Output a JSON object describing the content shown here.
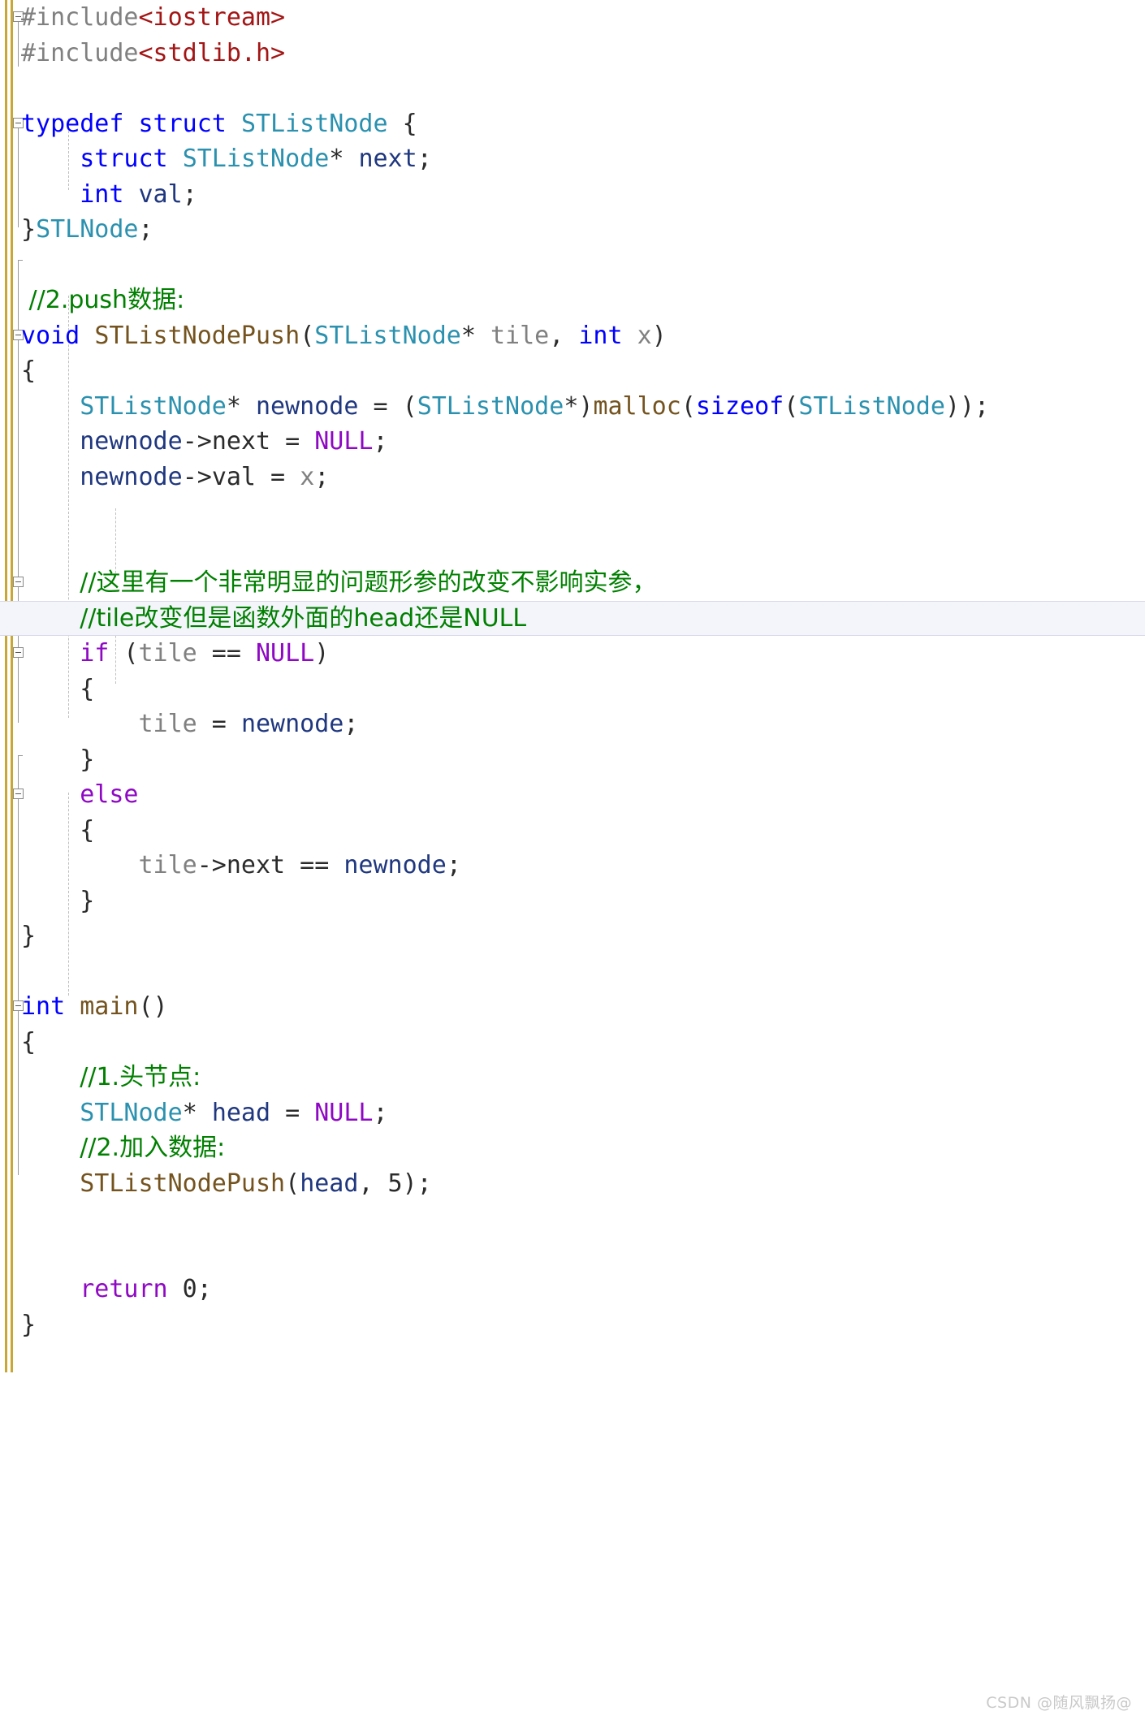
{
  "app": {
    "kind": "code-editor",
    "language": "C",
    "theme": "light"
  },
  "colors": {
    "background": "#ffffff",
    "keyword_blue": "#0000ff",
    "keyword_purple": "#8f08c4",
    "user_type_teal": "#2b91af",
    "function_brown": "#74531f",
    "preprocessor_gray": "#808080",
    "include_string_red": "#a31515",
    "comment_green": "#008000",
    "local_variable_navy": "#1f377f",
    "plain_text": "#2b2b2b",
    "change_bar": "#c8a734",
    "current_line_highlight": "#f4f4fb",
    "watermark": "#c9c9c9"
  },
  "watermark": {
    "text": "CSDN @随风飘扬@"
  },
  "code": {
    "lines": [
      {
        "n": 1,
        "fold": true,
        "current": false,
        "text": "#include<iostream>",
        "tokens": [
          {
            "t": "#include",
            "c": "pre"
          },
          {
            "t": "<iostream>",
            "c": "str"
          }
        ]
      },
      {
        "n": 2,
        "fold": false,
        "current": false,
        "text": "#include<stdlib.h>",
        "tokens": [
          {
            "t": "#include",
            "c": "pre"
          },
          {
            "t": "<stdlib.h>",
            "c": "str"
          }
        ]
      },
      {
        "n": 3,
        "fold": false,
        "current": false,
        "text": "",
        "tokens": []
      },
      {
        "n": 4,
        "fold": true,
        "current": false,
        "text": "typedef struct STListNode {",
        "tokens": [
          {
            "t": "typedef",
            "c": "kw"
          },
          {
            "t": " ",
            "c": "plain"
          },
          {
            "t": "struct",
            "c": "kw"
          },
          {
            "t": " ",
            "c": "plain"
          },
          {
            "t": "STListNode",
            "c": "type"
          },
          {
            "t": " {",
            "c": "plain"
          }
        ]
      },
      {
        "n": 5,
        "fold": false,
        "current": false,
        "text": "    struct STListNode* next;",
        "tokens": [
          {
            "t": "    ",
            "c": "plain"
          },
          {
            "t": "struct",
            "c": "kw"
          },
          {
            "t": " ",
            "c": "plain"
          },
          {
            "t": "STListNode",
            "c": "type"
          },
          {
            "t": "* ",
            "c": "plain"
          },
          {
            "t": "next",
            "c": "var"
          },
          {
            "t": ";",
            "c": "plain"
          }
        ]
      },
      {
        "n": 6,
        "fold": false,
        "current": false,
        "text": "    int val;",
        "tokens": [
          {
            "t": "    ",
            "c": "plain"
          },
          {
            "t": "int",
            "c": "kw"
          },
          {
            "t": " ",
            "c": "plain"
          },
          {
            "t": "val",
            "c": "var"
          },
          {
            "t": ";",
            "c": "plain"
          }
        ]
      },
      {
        "n": 7,
        "fold": false,
        "current": false,
        "text": "}STLNode;",
        "tokens": [
          {
            "t": "}",
            "c": "plain"
          },
          {
            "t": "STLNode",
            "c": "type"
          },
          {
            "t": ";",
            "c": "plain"
          }
        ]
      },
      {
        "n": 8,
        "fold": false,
        "current": false,
        "text": "",
        "tokens": []
      },
      {
        "n": 9,
        "fold": false,
        "current": false,
        "text": " //2.push数据:",
        "tokens": [
          {
            "t": " //2.push数据:",
            "c": "com"
          }
        ]
      },
      {
        "n": 10,
        "fold": true,
        "current": false,
        "text": "void STListNodePush(STListNode* tile, int x)",
        "tokens": [
          {
            "t": "void",
            "c": "kw"
          },
          {
            "t": " ",
            "c": "plain"
          },
          {
            "t": "STListNodePush",
            "c": "fn"
          },
          {
            "t": "(",
            "c": "plain"
          },
          {
            "t": "STListNode",
            "c": "type"
          },
          {
            "t": "* ",
            "c": "plain"
          },
          {
            "t": "tile",
            "c": "param"
          },
          {
            "t": ", ",
            "c": "plain"
          },
          {
            "t": "int",
            "c": "kw"
          },
          {
            "t": " ",
            "c": "plain"
          },
          {
            "t": "x",
            "c": "param"
          },
          {
            "t": ")",
            "c": "plain"
          }
        ]
      },
      {
        "n": 11,
        "fold": false,
        "current": false,
        "text": "{",
        "tokens": [
          {
            "t": "{",
            "c": "plain"
          }
        ]
      },
      {
        "n": 12,
        "fold": false,
        "current": false,
        "text": "    STListNode* newnode = (STListNode*)malloc(sizeof(STListNode));",
        "tokens": [
          {
            "t": "    ",
            "c": "plain"
          },
          {
            "t": "STListNode",
            "c": "type"
          },
          {
            "t": "* ",
            "c": "plain"
          },
          {
            "t": "newnode",
            "c": "var"
          },
          {
            "t": " = (",
            "c": "plain"
          },
          {
            "t": "STListNode",
            "c": "type"
          },
          {
            "t": "*)",
            "c": "plain"
          },
          {
            "t": "malloc",
            "c": "fn"
          },
          {
            "t": "(",
            "c": "plain"
          },
          {
            "t": "sizeof",
            "c": "kw"
          },
          {
            "t": "(",
            "c": "plain"
          },
          {
            "t": "STListNode",
            "c": "type"
          },
          {
            "t": "));",
            "c": "plain"
          }
        ]
      },
      {
        "n": 13,
        "fold": false,
        "current": false,
        "text": "    newnode->next = NULL;",
        "tokens": [
          {
            "t": "    ",
            "c": "plain"
          },
          {
            "t": "newnode",
            "c": "var"
          },
          {
            "t": "->",
            "c": "plain"
          },
          {
            "t": "next",
            "c": "plain"
          },
          {
            "t": " = ",
            "c": "plain"
          },
          {
            "t": "NULL",
            "c": "kw2"
          },
          {
            "t": ";",
            "c": "plain"
          }
        ]
      },
      {
        "n": 14,
        "fold": false,
        "current": false,
        "text": "    newnode->val = x;",
        "tokens": [
          {
            "t": "    ",
            "c": "plain"
          },
          {
            "t": "newnode",
            "c": "var"
          },
          {
            "t": "->",
            "c": "plain"
          },
          {
            "t": "val",
            "c": "plain"
          },
          {
            "t": " = ",
            "c": "plain"
          },
          {
            "t": "x",
            "c": "param"
          },
          {
            "t": ";",
            "c": "plain"
          }
        ]
      },
      {
        "n": 15,
        "fold": false,
        "current": false,
        "text": "",
        "tokens": []
      },
      {
        "n": 16,
        "fold": false,
        "current": false,
        "text": "",
        "tokens": []
      },
      {
        "n": 17,
        "fold": true,
        "current": false,
        "text": "    //这里有一个非常明显的问题形参的改变不影响实参，",
        "tokens": [
          {
            "t": "    ",
            "c": "plain"
          },
          {
            "t": "//这里有一个非常明显的问题形参的改变不影响实参，",
            "c": "com"
          }
        ]
      },
      {
        "n": 18,
        "fold": false,
        "current": true,
        "text": "    //tile改变但是函数外面的head还是NULL",
        "tokens": [
          {
            "t": "    ",
            "c": "plain"
          },
          {
            "t": "//tile改变但是函数外面的head还是NULL",
            "c": "com"
          }
        ]
      },
      {
        "n": 19,
        "fold": true,
        "current": false,
        "text": "    if (tile == NULL)",
        "tokens": [
          {
            "t": "    ",
            "c": "plain"
          },
          {
            "t": "if",
            "c": "kw2"
          },
          {
            "t": " (",
            "c": "plain"
          },
          {
            "t": "tile",
            "c": "param"
          },
          {
            "t": " == ",
            "c": "plain"
          },
          {
            "t": "NULL",
            "c": "kw2"
          },
          {
            "t": ")",
            "c": "plain"
          }
        ]
      },
      {
        "n": 20,
        "fold": false,
        "current": false,
        "text": "    {",
        "tokens": [
          {
            "t": "    {",
            "c": "plain"
          }
        ]
      },
      {
        "n": 21,
        "fold": false,
        "current": false,
        "text": "        tile = newnode;",
        "tokens": [
          {
            "t": "        ",
            "c": "plain"
          },
          {
            "t": "tile",
            "c": "param"
          },
          {
            "t": " = ",
            "c": "plain"
          },
          {
            "t": "newnode",
            "c": "var"
          },
          {
            "t": ";",
            "c": "plain"
          }
        ]
      },
      {
        "n": 22,
        "fold": false,
        "current": false,
        "text": "    }",
        "tokens": [
          {
            "t": "    }",
            "c": "plain"
          }
        ]
      },
      {
        "n": 23,
        "fold": true,
        "current": false,
        "text": "    else",
        "tokens": [
          {
            "t": "    ",
            "c": "plain"
          },
          {
            "t": "else",
            "c": "kw2"
          }
        ]
      },
      {
        "n": 24,
        "fold": false,
        "current": false,
        "text": "    {",
        "tokens": [
          {
            "t": "    {",
            "c": "plain"
          }
        ]
      },
      {
        "n": 25,
        "fold": false,
        "current": false,
        "text": "        tile->next == newnode;",
        "tokens": [
          {
            "t": "        ",
            "c": "plain"
          },
          {
            "t": "tile",
            "c": "param"
          },
          {
            "t": "->",
            "c": "plain"
          },
          {
            "t": "next",
            "c": "plain"
          },
          {
            "t": " == ",
            "c": "plain"
          },
          {
            "t": "newnode",
            "c": "var"
          },
          {
            "t": ";",
            "c": "plain"
          }
        ]
      },
      {
        "n": 26,
        "fold": false,
        "current": false,
        "text": "    }",
        "tokens": [
          {
            "t": "    }",
            "c": "plain"
          }
        ]
      },
      {
        "n": 27,
        "fold": false,
        "current": false,
        "text": "}",
        "tokens": [
          {
            "t": "}",
            "c": "plain"
          }
        ]
      },
      {
        "n": 28,
        "fold": false,
        "current": false,
        "text": "",
        "tokens": []
      },
      {
        "n": 29,
        "fold": true,
        "current": false,
        "text": "int main()",
        "tokens": [
          {
            "t": "int",
            "c": "kw"
          },
          {
            "t": " ",
            "c": "plain"
          },
          {
            "t": "main",
            "c": "fn"
          },
          {
            "t": "()",
            "c": "plain"
          }
        ]
      },
      {
        "n": 30,
        "fold": false,
        "current": false,
        "text": "{",
        "tokens": [
          {
            "t": "{",
            "c": "plain"
          }
        ]
      },
      {
        "n": 31,
        "fold": false,
        "current": false,
        "text": "    //1.头节点:",
        "tokens": [
          {
            "t": "    ",
            "c": "plain"
          },
          {
            "t": "//1.头节点:",
            "c": "com"
          }
        ]
      },
      {
        "n": 32,
        "fold": false,
        "current": false,
        "text": "    STLNode* head = NULL;",
        "tokens": [
          {
            "t": "    ",
            "c": "plain"
          },
          {
            "t": "STLNode",
            "c": "type"
          },
          {
            "t": "* ",
            "c": "plain"
          },
          {
            "t": "head",
            "c": "var"
          },
          {
            "t": " = ",
            "c": "plain"
          },
          {
            "t": "NULL",
            "c": "kw2"
          },
          {
            "t": ";",
            "c": "plain"
          }
        ]
      },
      {
        "n": 33,
        "fold": false,
        "current": false,
        "text": "    //2.加入数据:",
        "tokens": [
          {
            "t": "    ",
            "c": "plain"
          },
          {
            "t": "//2.加入数据:",
            "c": "com"
          }
        ]
      },
      {
        "n": 34,
        "fold": false,
        "current": false,
        "text": "    STListNodePush(head, 5);",
        "tokens": [
          {
            "t": "    ",
            "c": "plain"
          },
          {
            "t": "STListNodePush",
            "c": "fn"
          },
          {
            "t": "(",
            "c": "plain"
          },
          {
            "t": "head",
            "c": "var"
          },
          {
            "t": ", 5);",
            "c": "plain"
          }
        ]
      },
      {
        "n": 35,
        "fold": false,
        "current": false,
        "text": "",
        "tokens": []
      },
      {
        "n": 36,
        "fold": false,
        "current": false,
        "text": "",
        "tokens": []
      },
      {
        "n": 37,
        "fold": false,
        "current": false,
        "text": "    return 0;",
        "tokens": [
          {
            "t": "    ",
            "c": "plain"
          },
          {
            "t": "return",
            "c": "kw2"
          },
          {
            "t": " 0;",
            "c": "plain"
          }
        ]
      },
      {
        "n": 38,
        "fold": false,
        "current": false,
        "text": "}",
        "tokens": [
          {
            "t": "}",
            "c": "plain"
          }
        ]
      }
    ]
  }
}
